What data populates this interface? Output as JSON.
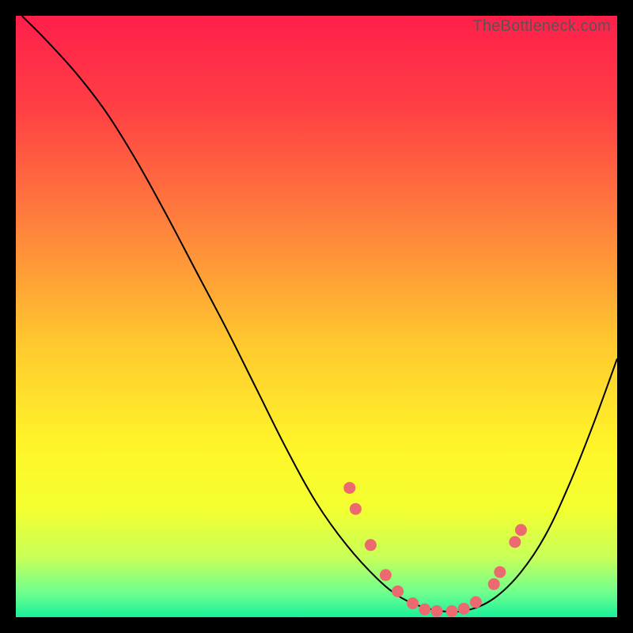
{
  "watermark": "TheBottleneck.com",
  "chart_data": {
    "type": "line",
    "title": "",
    "xlabel": "",
    "ylabel": "",
    "xlim": [
      0,
      100
    ],
    "ylim": [
      0,
      100
    ],
    "background_gradient": {
      "stops": [
        {
          "pos": 0.0,
          "color": "#ff1f4b"
        },
        {
          "pos": 0.15,
          "color": "#ff3e44"
        },
        {
          "pos": 0.35,
          "color": "#ff823c"
        },
        {
          "pos": 0.55,
          "color": "#ffca2e"
        },
        {
          "pos": 0.72,
          "color": "#fff629"
        },
        {
          "pos": 0.82,
          "color": "#f3ff30"
        },
        {
          "pos": 0.9,
          "color": "#c8ff58"
        },
        {
          "pos": 0.96,
          "color": "#6dff8e"
        },
        {
          "pos": 1.0,
          "color": "#19f09a"
        }
      ]
    },
    "series": [
      {
        "name": "curve",
        "color": "#000000",
        "width": 2,
        "x": [
          1,
          5,
          10,
          15,
          20,
          25,
          30,
          35,
          40,
          45,
          50,
          55,
          60,
          64,
          68,
          72,
          76,
          80,
          84,
          88,
          92,
          96,
          100
        ],
        "y": [
          100,
          96,
          90.5,
          84,
          76,
          67,
          57.5,
          48,
          38,
          28,
          19,
          12,
          6.5,
          3.3,
          1.6,
          0.9,
          1.4,
          3.5,
          7.5,
          13.5,
          22,
          32,
          43
        ]
      }
    ],
    "markers": {
      "color": "#ec6a6f",
      "radius": 7.5,
      "points": [
        {
          "x": 55.5,
          "y": 21.5
        },
        {
          "x": 56.5,
          "y": 18.0
        },
        {
          "x": 59.0,
          "y": 12.0
        },
        {
          "x": 61.5,
          "y": 7.0
        },
        {
          "x": 63.5,
          "y": 4.3
        },
        {
          "x": 66.0,
          "y": 2.3
        },
        {
          "x": 68.0,
          "y": 1.3
        },
        {
          "x": 70.0,
          "y": 1.0
        },
        {
          "x": 72.5,
          "y": 1.0
        },
        {
          "x": 74.5,
          "y": 1.4
        },
        {
          "x": 76.5,
          "y": 2.5
        },
        {
          "x": 79.5,
          "y": 5.5
        },
        {
          "x": 80.5,
          "y": 7.5
        },
        {
          "x": 83.0,
          "y": 12.5
        },
        {
          "x": 84.0,
          "y": 14.5
        }
      ]
    }
  }
}
